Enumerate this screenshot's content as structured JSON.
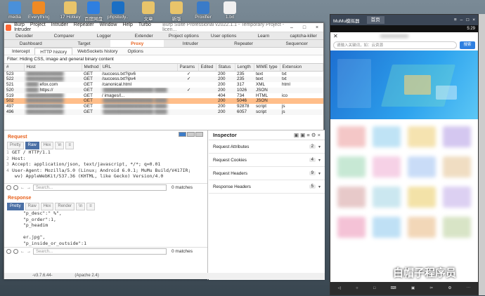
{
  "desktop": {
    "icons": [
      {
        "label": "media",
        "color": "#4a90d9"
      },
      {
        "label": "Everything",
        "color": "#f08a24"
      },
      {
        "label": "17 Hotkey",
        "color": "#e9c46a"
      },
      {
        "label": "百度网盘",
        "color": "#2f7fe0"
      },
      {
        "label": "phpstudy...",
        "color": "#1b6fc4"
      },
      {
        "label": "文章",
        "color": "#e9c46a"
      },
      {
        "label": "新版",
        "color": "#e9c46a"
      },
      {
        "label": "Proxifier",
        "color": "#3a7bc8"
      },
      {
        "label": "1.txt",
        "color": "#f0f0f0"
      }
    ]
  },
  "burp": {
    "menu": [
      "Burp",
      "Project",
      "Intruder",
      "Repeater",
      "Window",
      "Help",
      "Turbo Intruder"
    ],
    "title": "Burp Suite Professional v2022.1.1 - Temporary Project - licen...",
    "tabs_top": [
      "Decoder",
      "Comparer",
      "Logger",
      "Extender",
      "Project options",
      "User options",
      "Learn",
      "captcha-killer"
    ],
    "tabs_second": [
      "Dashboard",
      "Target",
      "Proxy",
      "Intruder",
      "Repeater",
      "Sequencer"
    ],
    "active_second": "Proxy",
    "subtabs": [
      "Intercept",
      "HTTP history",
      "WebSockets history",
      "Options"
    ],
    "active_sub": "HTTP history",
    "filter": "Filter: Hiding CSS, image and general binary content",
    "columns": [
      "#",
      "Host",
      "Method",
      "URL",
      "Params",
      "Edited",
      "Status",
      "Length",
      "MIME type",
      "Extension"
    ],
    "rows": [
      {
        "id": "523",
        "host": "",
        "method": "GET",
        "url": "/success.txt?ipv6",
        "params": "✓",
        "status": "200",
        "length": "235",
        "mime": "text",
        "ext": "txt",
        "sel": false
      },
      {
        "id": "522",
        "host": "",
        "method": "GET",
        "url": "/success.txt?ipv4",
        "params": "✓",
        "status": "200",
        "length": "235",
        "mime": "text",
        "ext": "txt",
        "sel": false
      },
      {
        "id": "521",
        "host": "efox.com",
        "method": "GET",
        "url": "/canonical.html",
        "params": "",
        "status": "200",
        "length": "317",
        "mime": "XML",
        "ext": "html",
        "sel": false
      },
      {
        "id": "520",
        "host": "https://",
        "method": "GET",
        "url": "",
        "params": "✓",
        "status": "200",
        "length": "1026",
        "mime": "JSON",
        "ext": "",
        "sel": false
      },
      {
        "id": "519",
        "host": "",
        "method": "GET",
        "url": "/ images/l...",
        "params": "",
        "status": "404",
        "length": "734",
        "mime": "HTML",
        "ext": "ico",
        "sel": false
      },
      {
        "id": "502",
        "host": "",
        "method": "GET",
        "url": "",
        "params": "",
        "status": "200",
        "length": "5046",
        "mime": "JSON",
        "ext": "",
        "sel": true
      },
      {
        "id": "497",
        "host": "",
        "method": "GET",
        "url": "",
        "params": "",
        "status": "200",
        "length": "92878",
        "mime": "script",
        "ext": "js",
        "sel": false
      },
      {
        "id": "496",
        "host": "",
        "method": "GET",
        "url": "",
        "params": "",
        "status": "200",
        "length": "6057",
        "mime": "script",
        "ext": "js",
        "sel": false
      }
    ],
    "request": {
      "title": "Request",
      "buttons": [
        "Pretty",
        "Raw",
        "Hex",
        "\\n",
        "≡"
      ],
      "active": "Raw",
      "lines": [
        {
          "n": "1",
          "t": "GET /                                    HTTP/1.1"
        },
        {
          "n": "2",
          "t": "Host:"
        },
        {
          "n": "3",
          "t": "Accept: application/json, text/javascript, */*; q=0.01"
        },
        {
          "n": "4",
          "t": "User-Agent: Mozilla/5.0 (Linux; Android 6.0.1; MuMu Build/V417IR;"
        },
        {
          "n": "",
          "t": "  wv) AppleWebKit/537.36 (KHTML, like Gecko) Version/4.0"
        }
      ],
      "search_placeholder": "Search...",
      "matches": "0 matches"
    },
    "response": {
      "title": "Response",
      "buttons": [
        "Pretty",
        "Raw",
        "Hex",
        "Render",
        "\\n",
        "≡"
      ],
      "active": "Pretty",
      "lines": [
        {
          "n": "",
          "t": "\"p_desc\":\"                %\","
        },
        {
          "n": "",
          "t": "\"p_order\":1,"
        },
        {
          "n": "",
          "t": "\"p_headim"
        },
        {
          "n": "",
          "t": ""
        },
        {
          "n": "",
          "t": "er.jpg\","
        },
        {
          "n": "",
          "t": "\"p_inside_or_outside\":1"
        }
      ],
      "search_placeholder": "Search...",
      "matches": "0 matches"
    },
    "inspector": {
      "title": "Inspector",
      "rows": [
        {
          "label": "Request Attributes",
          "count": "2"
        },
        {
          "label": "Request Cookies",
          "count": "4"
        },
        {
          "label": "Request Headers",
          "count": "9"
        },
        {
          "label": "Response Headers",
          "count": "5"
        }
      ]
    },
    "status_left": "-v3.7.6.44-",
    "status_right": "(Apache 2.4)"
  },
  "emulator": {
    "title": "MuMu模拟器",
    "tab": "首页",
    "time": "5:29",
    "search_placeholder": "请输入关键词，如：云资源",
    "search_button": "搜索",
    "grid_label": "50+推荐",
    "bottom": [
      "",
      "",
      "",
      "",
      "",
      "",
      "",
      ""
    ]
  },
  "watermark": "白帽子程序员"
}
